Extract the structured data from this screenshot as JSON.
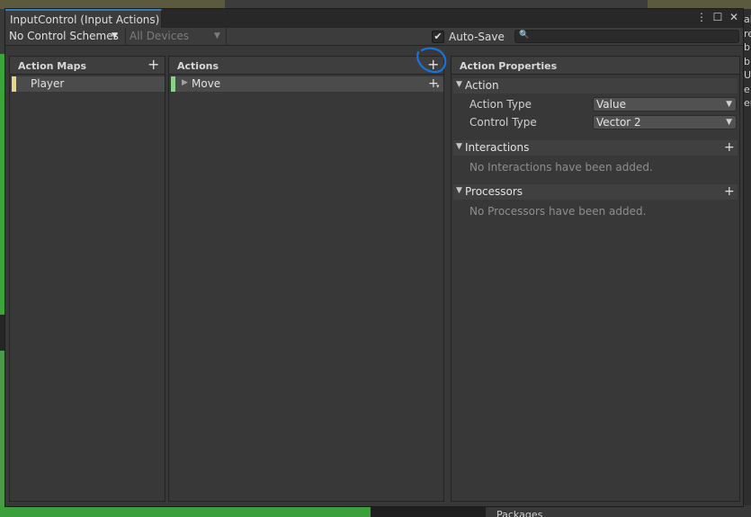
{
  "window": {
    "tab_title": "InputControl (Input Actions)",
    "controls": [
      "⋮",
      "☐",
      "✕"
    ]
  },
  "toolbar": {
    "control_schemes": "No Control Schemes",
    "devices": "All Devices",
    "auto_save_label": "Auto-Save",
    "auto_save_checked": true,
    "search_value": ""
  },
  "action_maps": {
    "title": "Action Maps",
    "items": [
      {
        "label": "Player",
        "color": "#e8d684"
      }
    ]
  },
  "actions": {
    "title": "Actions",
    "items": [
      {
        "label": "Move",
        "color": "#8ad28a"
      }
    ]
  },
  "properties": {
    "title": "Action Properties",
    "action_group": "Action",
    "action_type_label": "Action Type",
    "action_type_value": "Value",
    "control_type_label": "Control Type",
    "control_type_value": "Vector 2",
    "interactions_group": "Interactions",
    "interactions_empty": "No Interactions have been added.",
    "processors_group": "Processors",
    "processors_empty": "No Processors have been added."
  },
  "background": {
    "right_panel_text": "ai\nre\nb\nbl\nU\ne\nen",
    "packages_label": "Packages"
  },
  "colors": {
    "tab_accent": "#3a79bb",
    "annotation_circle": "#1a73d9"
  }
}
